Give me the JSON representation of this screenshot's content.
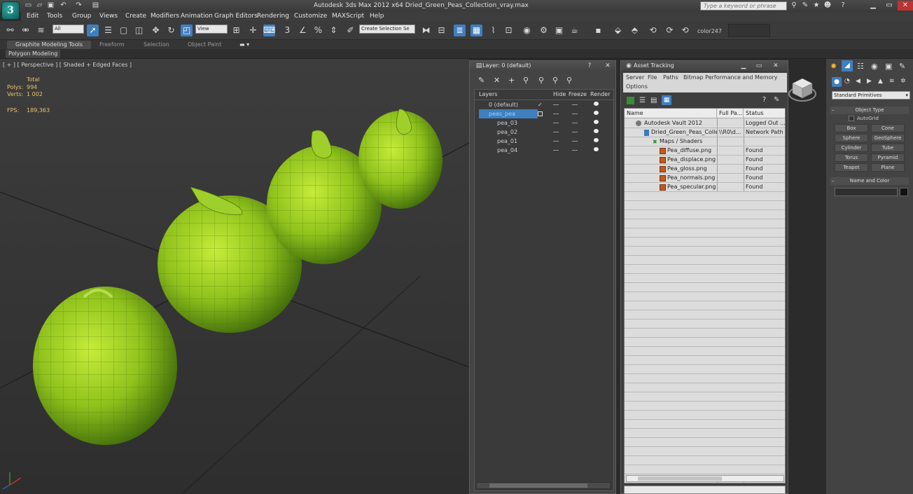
{
  "titlebar": {
    "logo": "3",
    "title": "Autodesk 3ds Max  2012 x64     Dried_Green_Peas_Collection_vray.max",
    "search_placeholder": "Type a keyword or phrase"
  },
  "menubar": {
    "items": [
      "Edit",
      "Tools",
      "Group",
      "Views",
      "Create",
      "Modifiers",
      "Animation",
      "Graph Editors",
      "Rendering",
      "Customize",
      "MAXScript",
      "Help"
    ]
  },
  "toolbar": {
    "filter_value": "All",
    "refcoord_value": "View",
    "selection_set": "Create Selection Se",
    "color_label": "color247"
  },
  "ribbon": {
    "tabs": [
      "Graphite Modeling Tools",
      "Freeform",
      "Selection",
      "Object Paint"
    ],
    "sub_tab": "Polygon Modeling"
  },
  "viewport": {
    "label": "[ + ] [ Perspective ] [ Shaded + Edged Faces ]",
    "stats": {
      "total_label": "Total",
      "polys_label": "Polys:",
      "polys_value": "994",
      "verts_label": "Verts:",
      "verts_value": "1 002",
      "fps_label": "FPS:",
      "fps_value": "189,363"
    }
  },
  "layer_window": {
    "title": "Layer: 0 (default)",
    "columns": [
      "Layers",
      "Hide",
      "Freeze",
      "Render"
    ],
    "rows": [
      {
        "name": "0 (default)",
        "indent": 0
      },
      {
        "name": "peas_pea",
        "indent": 0
      },
      {
        "name": "pea_03",
        "indent": 1
      },
      {
        "name": "pea_02",
        "indent": 1
      },
      {
        "name": "pea_01",
        "indent": 1
      },
      {
        "name": "pea_04",
        "indent": 1
      }
    ]
  },
  "asset_window": {
    "title": "Asset Tracking",
    "menu": [
      "Server",
      "File",
      "Paths",
      "Bitmap Performance and Memory",
      "Options"
    ],
    "columns": [
      "Name",
      "Full Pa...",
      "Status"
    ],
    "rows": [
      {
        "name": "Autodesk Vault 2012",
        "path": "",
        "status": "Logged Out ..."
      },
      {
        "name": "Dried_Green_Peas_Colle...",
        "path": "\\\\R0\\d...",
        "status": "Network Path"
      },
      {
        "name": "Maps / Shaders",
        "path": "",
        "status": ""
      },
      {
        "name": "Pea_diffuse.png",
        "path": "",
        "status": "Found"
      },
      {
        "name": "Pea_displace.png",
        "path": "",
        "status": "Found"
      },
      {
        "name": "Pea_gloss.png",
        "path": "",
        "status": "Found"
      },
      {
        "name": "Pea_normals.png",
        "path": "",
        "status": "Found"
      },
      {
        "name": "Pea_specular.png",
        "path": "",
        "status": "Found"
      }
    ]
  },
  "command_panel": {
    "category": "Standard Primitives",
    "object_type_title": "Object Type",
    "autogrid": "AutoGrid",
    "buttons": [
      "Box",
      "Cone",
      "Sphere",
      "GeoSphere",
      "Cylinder",
      "Tube",
      "Torus",
      "Pyramid",
      "Teapot",
      "Plane"
    ],
    "name_color_title": "Name and Color"
  }
}
